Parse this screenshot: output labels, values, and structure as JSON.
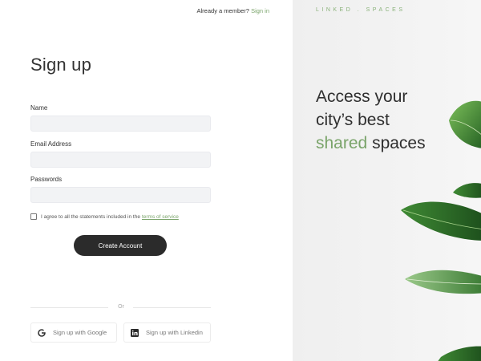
{
  "header": {
    "already_text": "Already a member?",
    "sign_in_label": "Sign in"
  },
  "form": {
    "title": "Sign up",
    "name_label": "Name",
    "name_value": "",
    "email_label": "Email Address",
    "email_value": "",
    "password_label": "Passwords",
    "password_value": "",
    "terms_text": "I agree to all the statements included in the",
    "terms_link": "terms of service",
    "terms_checked": false,
    "create_button": "Create Account",
    "divider_text": "Or",
    "google_button": "Sign up with Google",
    "linkedin_button": "Sign up with Linkedin"
  },
  "side": {
    "brand": "LINKED . SPACES",
    "hero_line1": "Access your",
    "hero_line2": "city’s best",
    "hero_accent": "shared",
    "hero_end": "spaces"
  },
  "colors": {
    "accent": "#7aa46a",
    "button_dark": "#2b2b2b",
    "input_bg": "#f2f3f5",
    "panel_bg": "#f0f0f0",
    "leaf_green": "#2f6e2a"
  },
  "icons": [
    "google-icon",
    "linkedin-icon",
    "leaf-decoration"
  ]
}
